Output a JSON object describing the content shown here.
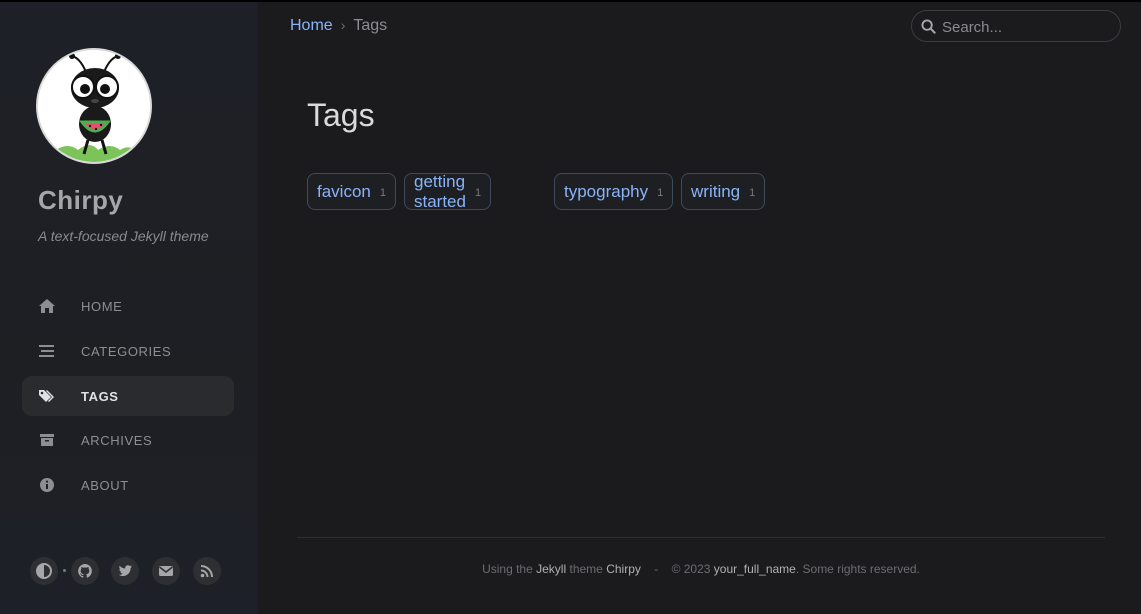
{
  "sidebar": {
    "site_title": "Chirpy",
    "site_subtitle": "A text-focused Jekyll theme",
    "nav": [
      {
        "label": "HOME",
        "icon": "home-icon"
      },
      {
        "label": "CATEGORIES",
        "icon": "stream-icon"
      },
      {
        "label": "TAGS",
        "icon": "tags-icon",
        "active": true
      },
      {
        "label": "ARCHIVES",
        "icon": "archive-icon"
      },
      {
        "label": "ABOUT",
        "icon": "info-icon"
      }
    ],
    "bottom_icons": [
      "mode-toggle-icon",
      "github-icon",
      "twitter-icon",
      "email-icon",
      "rss-icon"
    ]
  },
  "topbar": {
    "breadcrumb_home": "Home",
    "breadcrumb_sep": "›",
    "breadcrumb_current": "Tags",
    "search_placeholder": "Search..."
  },
  "main": {
    "title": "Tags",
    "tags": [
      {
        "name": "favicon",
        "count": "1"
      },
      {
        "name": "getting started",
        "count": "1"
      },
      {
        "name": "typography",
        "count": "1"
      },
      {
        "name": "writing",
        "count": "1"
      }
    ]
  },
  "footer": {
    "using": "Using the",
    "jekyll": "Jekyll",
    "theme": "theme",
    "chirpy": "Chirpy",
    "sep": "-",
    "copyright": "© 2023",
    "owner": "your_full_name",
    "rights": ". Some rights reserved."
  },
  "colors": {
    "accent": "#8ab4f8",
    "background": "#1b1b1e",
    "sidebar": "#1f2024"
  }
}
